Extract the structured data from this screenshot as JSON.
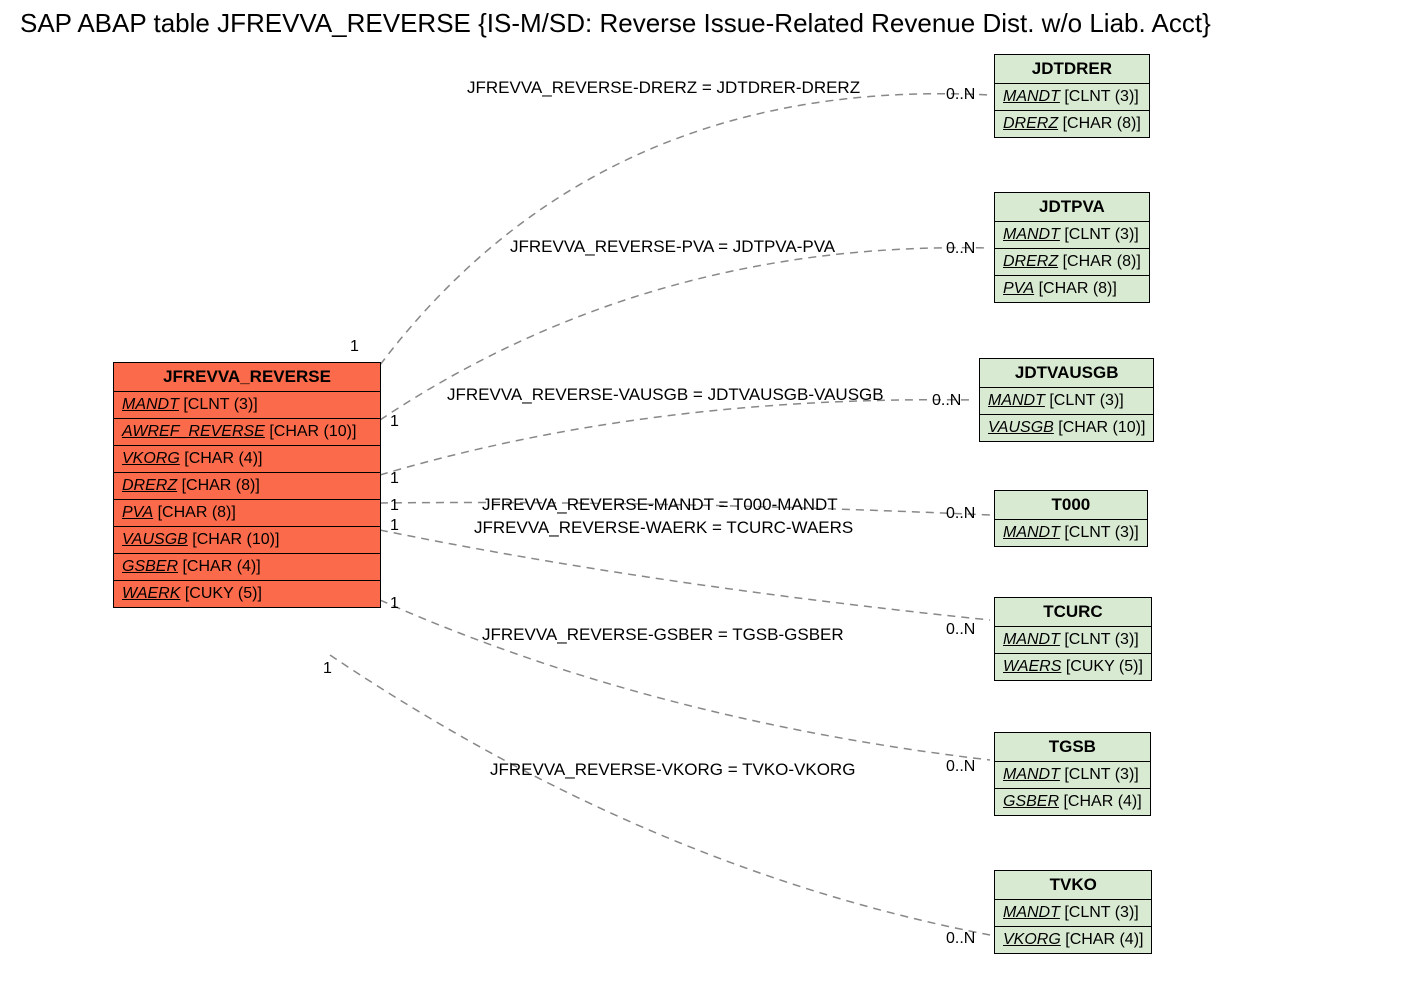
{
  "title": "SAP ABAP table JFREVVA_REVERSE {IS-M/SD: Reverse Issue-Related Revenue Dist. w/o Liab. Acct}",
  "main": {
    "name": "JFREVVA_REVERSE",
    "fields": [
      {
        "n": "MANDT",
        "t": "[CLNT (3)]"
      },
      {
        "n": "AWREF_REVERSE",
        "t": "[CHAR (10)]"
      },
      {
        "n": "VKORG",
        "t": "[CHAR (4)]"
      },
      {
        "n": "DRERZ",
        "t": "[CHAR (8)]"
      },
      {
        "n": "PVA",
        "t": "[CHAR (8)]"
      },
      {
        "n": "VAUSGB",
        "t": "[CHAR (10)]"
      },
      {
        "n": "GSBER",
        "t": "[CHAR (4)]"
      },
      {
        "n": "WAERK",
        "t": "[CUKY (5)]"
      }
    ]
  },
  "refs": [
    {
      "name": "JDTDRER",
      "fields": [
        {
          "n": "MANDT",
          "t": "[CLNT (3)]"
        },
        {
          "n": "DRERZ",
          "t": "[CHAR (8)]"
        }
      ]
    },
    {
      "name": "JDTPVA",
      "fields": [
        {
          "n": "MANDT",
          "t": "[CLNT (3)]"
        },
        {
          "n": "DRERZ",
          "t": "[CHAR (8)]"
        },
        {
          "n": "PVA",
          "t": "[CHAR (8)]"
        }
      ]
    },
    {
      "name": "JDTVAUSGB",
      "fields": [
        {
          "n": "MANDT",
          "t": "[CLNT (3)]"
        },
        {
          "n": "VAUSGB",
          "t": "[CHAR (10)]"
        }
      ]
    },
    {
      "name": "T000",
      "fields": [
        {
          "n": "MANDT",
          "t": "[CLNT (3)]"
        }
      ]
    },
    {
      "name": "TCURC",
      "fields": [
        {
          "n": "MANDT",
          "t": "[CLNT (3)]"
        },
        {
          "n": "WAERS",
          "t": "[CUKY (5)]"
        }
      ]
    },
    {
      "name": "TGSB",
      "fields": [
        {
          "n": "MANDT",
          "t": "[CLNT (3)]"
        },
        {
          "n": "GSBER",
          "t": "[CHAR (4)]"
        }
      ]
    },
    {
      "name": "TVKO",
      "fields": [
        {
          "n": "MANDT",
          "t": "[CLNT (3)]"
        },
        {
          "n": "VKORG",
          "t": "[CHAR (4)]"
        }
      ]
    }
  ],
  "rels": [
    "JFREVVA_REVERSE-DRERZ = JDTDRER-DRERZ",
    "JFREVVA_REVERSE-PVA = JDTPVA-PVA",
    "JFREVVA_REVERSE-VAUSGB = JDTVAUSGB-VAUSGB",
    "JFREVVA_REVERSE-MANDT = T000-MANDT",
    "JFREVVA_REVERSE-WAERK = TCURC-WAERS",
    "JFREVVA_REVERSE-GSBER = TGSB-GSBER",
    "JFREVVA_REVERSE-VKORG = TVKO-VKORG"
  ],
  "cardLeft": "1",
  "cardRight": "0..N"
}
